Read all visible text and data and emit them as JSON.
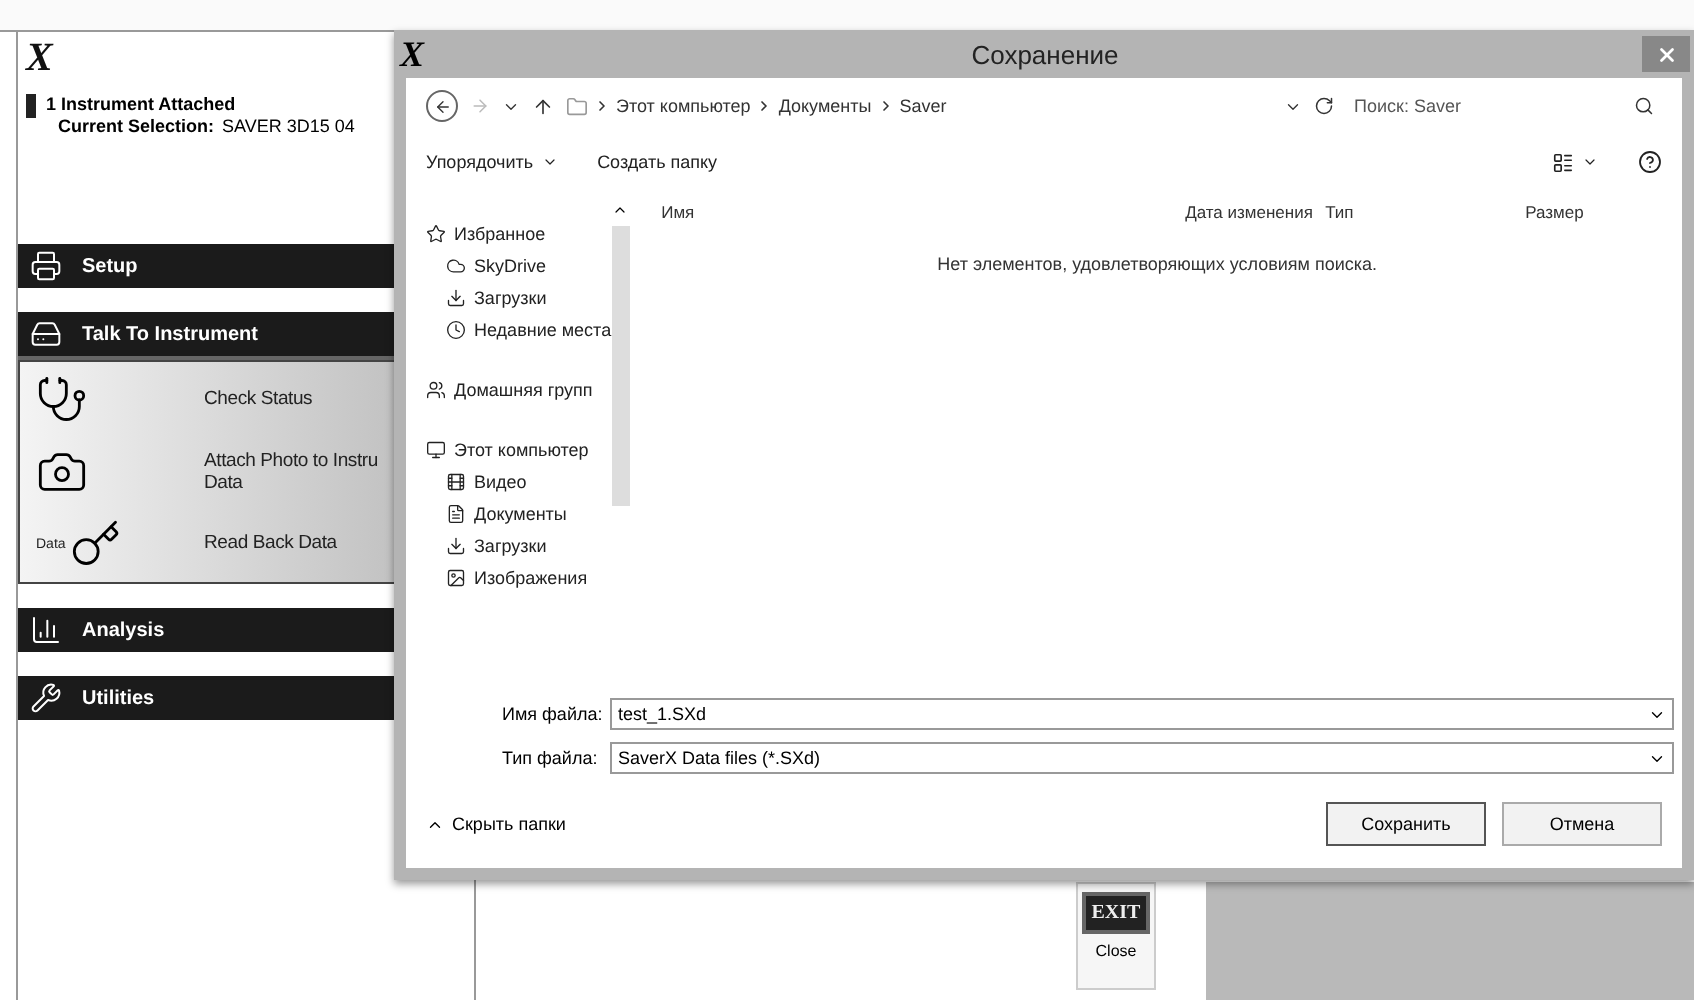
{
  "app": {
    "logo": "X",
    "status": {
      "title": "1 Instrument Attached",
      "selection_label": "Current Selection:",
      "selection_value": "SAVER 3D15 04"
    },
    "menu": [
      {
        "kind": "setup",
        "label": "Setup",
        "expanded": false
      },
      {
        "kind": "talk",
        "label": "Talk To Instrument",
        "expanded": true,
        "children": [
          {
            "kind": "status",
            "label": "Check Status"
          },
          {
            "kind": "photo",
            "label": "Attach Photo to Instru",
            "label_line2": "Data"
          },
          {
            "kind": "readback",
            "label": "Read Back Data",
            "icon_label": "Data"
          }
        ]
      },
      {
        "kind": "analysis",
        "label": "Analysis",
        "expanded": false
      },
      {
        "kind": "utilities",
        "label": "Utilities",
        "expanded": false
      }
    ],
    "exit_button": {
      "label": "EXIT",
      "caption": "Close"
    }
  },
  "dialog": {
    "logo": "X",
    "title": "Сохранение",
    "breadcrumb": [
      "Этот компьютер",
      "Документы",
      "Saver"
    ],
    "search": {
      "placeholder": "Поиск: Saver"
    },
    "toolbar": {
      "organize": "Упорядочить",
      "new_folder": "Создать папку"
    },
    "nav": [
      {
        "label": "Избранное",
        "kind": "star",
        "children": [
          {
            "label": "SkyDrive",
            "kind": "cloud"
          },
          {
            "label": "Загрузки",
            "kind": "download"
          },
          {
            "label": "Недавние места",
            "kind": "recent"
          }
        ]
      },
      {
        "label": "Домашняя групп",
        "kind": "group"
      },
      {
        "label": "Этот компьютер",
        "kind": "computer",
        "children": [
          {
            "label": "Видео",
            "kind": "video"
          },
          {
            "label": "Документы",
            "kind": "docs"
          },
          {
            "label": "Загрузки",
            "kind": "download"
          },
          {
            "label": "Изображения",
            "kind": "images"
          }
        ]
      }
    ],
    "columns": [
      "Имя",
      "Дата изменения",
      "Тип",
      "Размер"
    ],
    "empty_message": "Нет элементов, удовлетворяющих условиям поиска.",
    "filename": {
      "label": "Имя файла:",
      "value": "test_1.SXd"
    },
    "filetype": {
      "label": "Тип файла:",
      "value": "SaverX Data files (*.SXd)"
    },
    "hide_folders": "Скрыть папки",
    "buttons": [
      {
        "label": "Сохранить",
        "default": true
      },
      {
        "label": "Отмена",
        "default": false
      }
    ]
  }
}
